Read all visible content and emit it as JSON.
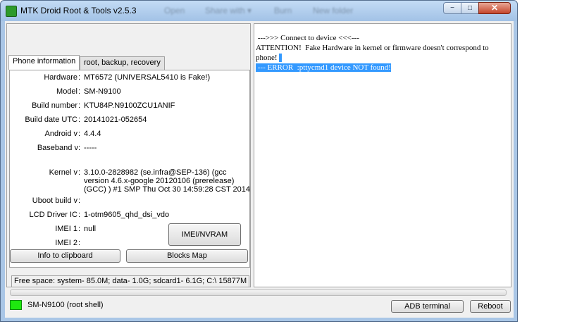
{
  "window": {
    "title": "MTK Droid Root & Tools v2.5.3",
    "ghost_menu": [
      "Open",
      "Share with ▾",
      "Burn",
      "New folder"
    ],
    "controls": {
      "minimize": "−",
      "maximize": "□",
      "close": "✕"
    }
  },
  "tabs": [
    {
      "label": "Phone information",
      "active": true
    },
    {
      "label": "root, backup, recovery",
      "active": false
    }
  ],
  "phone_info": [
    {
      "label": "Hardware",
      "value": "MT6572 (UNIVERSAL5410 is Fake!)"
    },
    {
      "label": "Model",
      "value": "SM-N9100"
    },
    {
      "label": "Build number",
      "value": "KTU84P.N9100ZCU1ANIF"
    },
    {
      "label": "Build date UTC",
      "value": "20141021-052654"
    },
    {
      "label": "Android  v",
      "value": "4.4.4"
    },
    {
      "label": "Baseband v:",
      "value": "-----"
    },
    {
      "label": "Kernel v",
      "value": "3.10.0-2828982 (se.infra@SEP-136) (gcc version 4.6.x-google 20120106 (prerelease) (GCC) ) #1 SMP  Thu Oct 30 14:59:28 CST 2014"
    },
    {
      "label": "Uboot build v",
      "value": ""
    },
    {
      "label": "LCD Driver IC",
      "value": "1-otm9605_qhd_dsi_vdo"
    },
    {
      "label": "IMEI 1",
      "value": "null"
    },
    {
      "label": "IMEI 2",
      "value": ""
    }
  ],
  "buttons": {
    "imei_nvram": "IMEI/NVRAM",
    "info_to_clipboard": "Info to clipboard",
    "blocks_map": "Blocks Map",
    "adb_terminal": "ADB terminal",
    "reboot": "Reboot"
  },
  "free_space": "Free space: system- 85.0M; data- 1.0G; sdcard1- 6.1G;  C:\\ 15877M",
  "console": {
    "line1": " --->>> Connect to device <<<---",
    "line2": "ATTENTION!  Fake Hardware in kernel or firmware doesn't correspond to phone! ",
    "line3_selected": " --- ERROR  :pttycmd1 device NOT found!"
  },
  "status": {
    "device": "SM-N9100 (root shell)",
    "indicator_color": "#1ee80f"
  }
}
